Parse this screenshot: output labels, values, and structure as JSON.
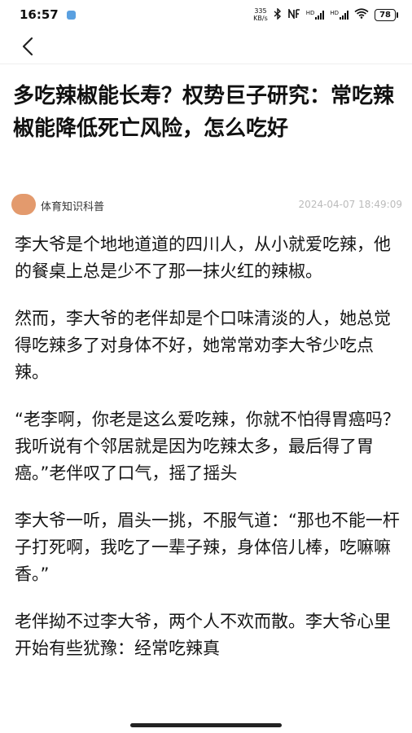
{
  "status_bar": {
    "time": "16:57",
    "net_speed_value": "335",
    "net_speed_unit": "KB/s",
    "hd_label_1": "HD",
    "hd_label_2": "HD",
    "battery": "78"
  },
  "nav": {
    "back_icon": "chevron-left-icon"
  },
  "article": {
    "title": "多吃辣椒能长寿？权势巨子研究：常吃辣椒能降低死亡风险，怎么吃好",
    "author": "体育知识科普",
    "timestamp": "2024-04-07 18:49:09",
    "paragraphs": [
      "李大爷是个地地道道的四川人，从小就爱吃辣，他的餐桌上总是少不了那一抹火红的辣椒。",
      "然而，李大爷的老伴却是个口味清淡的人，她总觉得吃辣多了对身体不好，她常常劝李大爷少吃点辣。",
      "“老李啊，你老是这么爱吃辣，你就不怕得胃癌吗？我听说有个邻居就是因为吃辣太多，最后得了胃癌。”老伴叹了口气，摇了摇头",
      "李大爷一听，眉头一挑，不服气道：“那也不能一杆子打死啊，我吃了一辈子辣，身体倍儿棒，吃嘛嘛香。”",
      "老伴拗不过李大爷，两个人不欢而散。李大爷心里开始有些犹豫：经常吃辣真"
    ]
  },
  "colors": {
    "avatar": "#e39a6d",
    "timestamp": "#bbbbbb",
    "text": "#161616"
  }
}
